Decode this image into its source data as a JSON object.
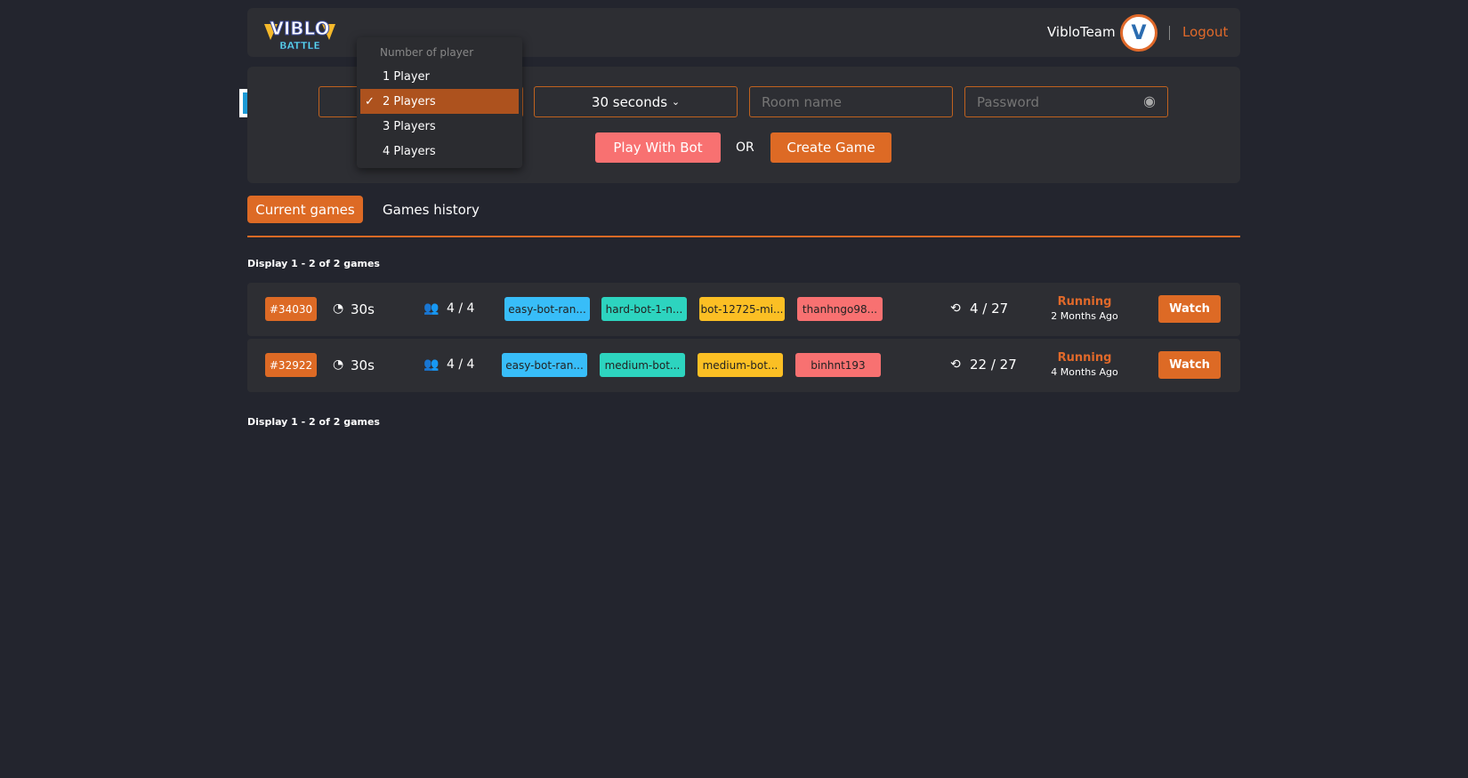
{
  "header": {
    "logo_top": "VIBLO",
    "logo_bottom": "BATTLE",
    "username": "VibloTeam",
    "avatar_letter": "V",
    "logout": "Logout"
  },
  "form": {
    "players_dropdown": {
      "title": "Number of player",
      "options": [
        "1 Player",
        "2 Players",
        "3 Players",
        "4 Players"
      ],
      "selected": "2 Players"
    },
    "time_select": "30 seconds",
    "room_placeholder": "Room name",
    "password_placeholder": "Password",
    "play_bot": "Play With Bot",
    "or": "OR",
    "create": "Create Game"
  },
  "tabs": [
    {
      "label": "Current games",
      "active": true
    },
    {
      "label": "Games history",
      "active": false
    }
  ],
  "display_text": "Display 1 - 2 of 2 games",
  "games": [
    {
      "id": "#34030",
      "time": "30s",
      "players": "4 / 4",
      "chips": [
        "easy-bot-ran...",
        "hard-bot-1-n...",
        "bot-12725-mi...",
        "thanhngo98..."
      ],
      "rounds": "4 / 27",
      "status": "Running",
      "ago": "2 Months Ago",
      "action": "Watch"
    },
    {
      "id": "#32922",
      "time": "30s",
      "players": "4 / 4",
      "chips": [
        "easy-bot-ran...",
        "medium-bot...",
        "medium-bot...",
        "binhnt193"
      ],
      "rounds": "22 / 27",
      "status": "Running",
      "ago": "4 Months Ago",
      "action": "Watch"
    }
  ],
  "colors": {
    "accent": "#dd6a25",
    "chips": [
      "#38bdf8",
      "#2dd4bf",
      "#fbbf24",
      "#f87171"
    ]
  }
}
